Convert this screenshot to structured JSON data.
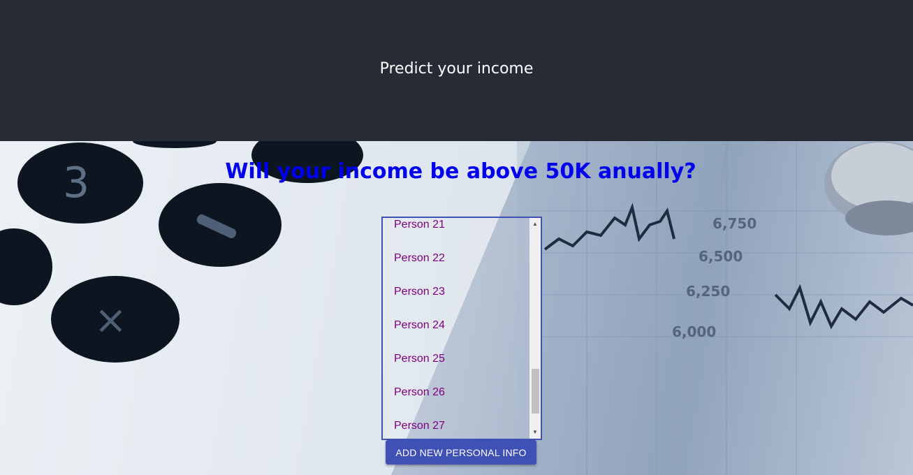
{
  "header": {
    "title": "Predict your income"
  },
  "main": {
    "question": "Will your income be above 50K anually?",
    "persons": [
      "Person 21",
      "Person 22",
      "Person 23",
      "Person 24",
      "Person 25",
      "Person 26",
      "Person 27"
    ],
    "add_button_label": "ADD NEW PERSONAL INFO"
  },
  "colors": {
    "header_bg": "#272b35",
    "question": "#0000ee",
    "list_item": "#800080",
    "accent": "#3f51b5"
  }
}
